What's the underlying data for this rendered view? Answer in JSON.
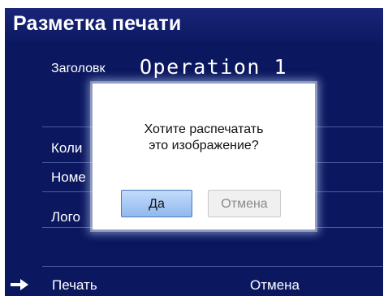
{
  "screen": {
    "title": "Разметка печати",
    "header_field": {
      "label": "Заголовк",
      "value": "Operation 1"
    },
    "rows": [
      {
        "label": "Коли"
      },
      {
        "label": "Номе"
      },
      {
        "label": "Лого"
      }
    ],
    "footer": {
      "print_label": "Печать",
      "cancel_label": "Отмена"
    }
  },
  "dialog": {
    "message_line1": "Хотите распечатать",
    "message_line2": "это изображение?",
    "yes_label": "Да",
    "cancel_label": "Отмена"
  },
  "colors": {
    "background": "#0b1860",
    "title_bar": "#1a2478",
    "dialog_bg": "#ffffff",
    "primary_button": "#a9cbf5"
  },
  "icons": {
    "print_pointer": "right-arrow-icon"
  }
}
